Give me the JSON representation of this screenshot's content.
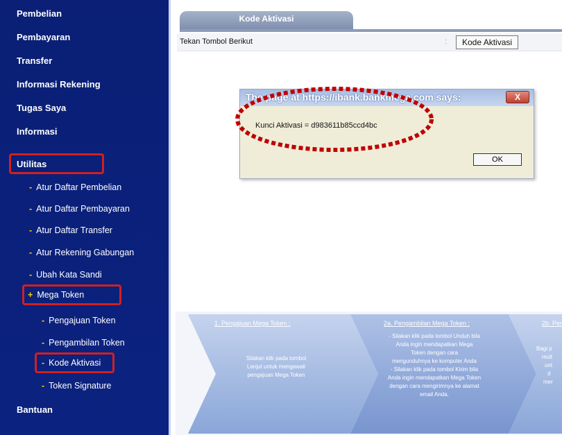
{
  "sidebar": {
    "items": [
      {
        "label": "Pembelian"
      },
      {
        "label": "Pembayaran"
      },
      {
        "label": "Transfer"
      },
      {
        "label": "Informasi Rekening"
      },
      {
        "label": "Tugas Saya"
      },
      {
        "label": "Informasi"
      },
      {
        "label": "Utilitas"
      }
    ],
    "utilitas_sub": [
      {
        "label": "Atur Daftar Pembelian"
      },
      {
        "label": "Atur Daftar Pembayaran"
      },
      {
        "label": "Atur Daftar Transfer"
      },
      {
        "label": "Atur Rekening Gabungan"
      },
      {
        "label": "Ubah Kata Sandi"
      }
    ],
    "mega_token": {
      "label": "Mega Token",
      "children": [
        {
          "label": "Pengajuan Token"
        },
        {
          "label": "Pengambilan Token"
        },
        {
          "label": "Kode Aktivasi"
        },
        {
          "label": "Token Signature"
        }
      ]
    },
    "bantuan": "Bantuan"
  },
  "main": {
    "tab_label": "Kode Aktivasi",
    "row_label": "Tekan Tombol Berikut",
    "row_colon": ":",
    "row_button": "Kode Aktivasi"
  },
  "dialog": {
    "title": "The page at https://ibank.bankmega.com says:",
    "close_label": "X",
    "message": "Kunci Aktivasi = d983611b85ccd4bc",
    "ok_label": "OK"
  },
  "banner": {
    "step1_title": "1. Pengajuan Mega Token :",
    "step1_body_1": "Silakan klik pada tombol",
    "step1_body_2": "Lanjut untuk mengawali",
    "step1_body_3": "pengajuan Mega Token",
    "step2_title": "2a. Pengambilan Mega Token :",
    "step2_body_1": "- Silakan klik pada tombol Unduh bila",
    "step2_body_2": "Anda ingin mendapatkan Mega",
    "step2_body_3": "Token dengan cara",
    "step2_body_4": "mengunduhnya ke komputer Anda",
    "step2_body_5": "- Silakan klik pada tombol Kirim bila",
    "step2_body_6": "Anda ingin mendapatkan Mega Token",
    "step2_body_7": "dengan cara mengirimnya ke alamat",
    "step2_body_8": "email Anda.",
    "step3_title": "2b. Peng",
    "step3_body_1": "Bagi p",
    "step3_body_2": "mult",
    "step3_body_3": "unt",
    "step3_body_4": "d",
    "step3_body_5": "mer"
  },
  "colors": {
    "sidebar_bg": "#0b2280",
    "highlight": "#d41f1f",
    "bullet": "#ffcc00",
    "banner_blue": "#8aa6d8"
  }
}
